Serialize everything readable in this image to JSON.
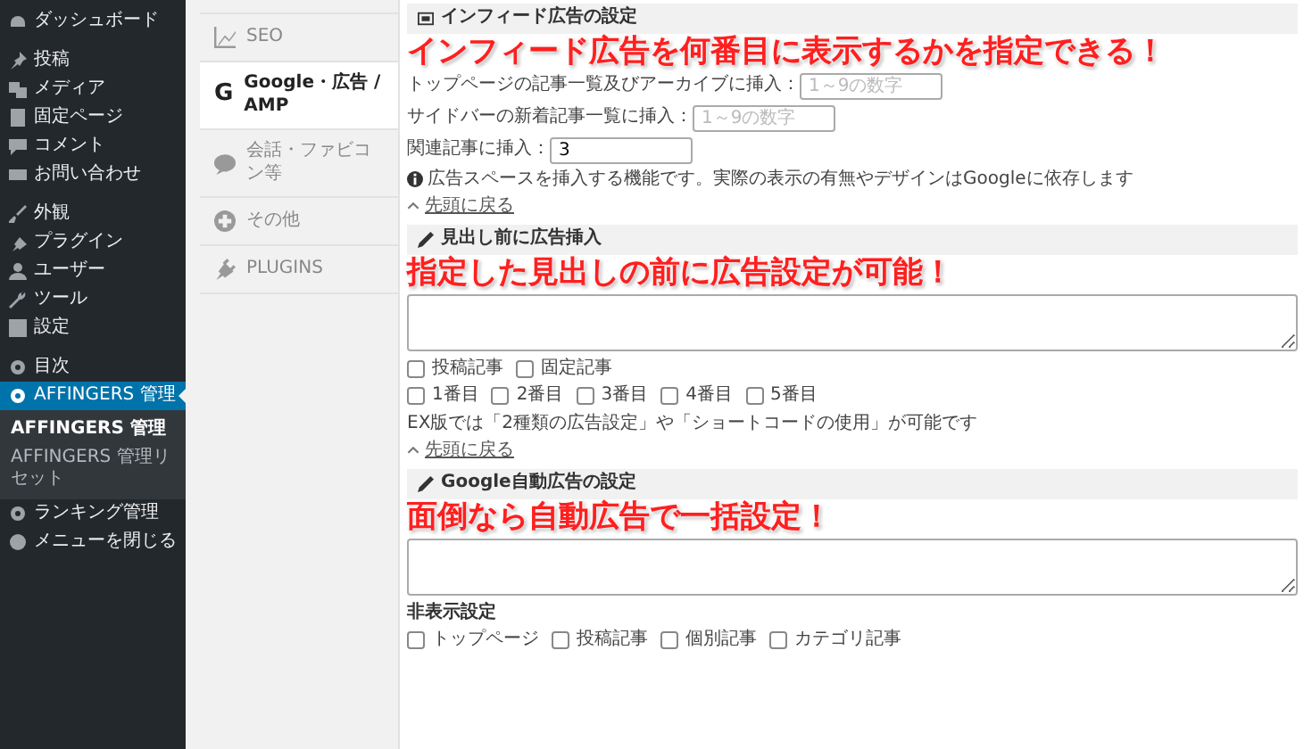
{
  "sidebar": {
    "groups": [
      {
        "items": [
          {
            "label": "ダッシュボード",
            "selected": false
          }
        ]
      },
      {
        "items": [
          {
            "label": "投稿",
            "selected": false
          },
          {
            "label": "メディア",
            "selected": false
          },
          {
            "label": "固定ページ",
            "selected": false
          },
          {
            "label": "コメント",
            "selected": false
          },
          {
            "label": "お問い合わせ",
            "selected": false
          }
        ]
      },
      {
        "items": [
          {
            "label": "外観",
            "selected": false
          },
          {
            "label": "プラグイン",
            "selected": false
          },
          {
            "label": "ユーザー",
            "selected": false
          },
          {
            "label": "ツール",
            "selected": false
          },
          {
            "label": "設定",
            "selected": false
          }
        ]
      },
      {
        "items": [
          {
            "label": "目次",
            "selected": false
          },
          {
            "label": "AFFINGERS 管理",
            "selected": true,
            "children": [
              {
                "label": "AFFINGERS 管理",
                "selected": true
              },
              {
                "label": "AFFINGERS 管理リセット",
                "selected": false
              }
            ]
          },
          {
            "label": "ランキング管理",
            "selected": false
          },
          {
            "label": "メニューを閉じる",
            "selected": false
          }
        ]
      }
    ]
  },
  "tabs": [
    {
      "label": "SEO",
      "selected": false
    },
    {
      "label": "Google・広告 / AMP",
      "glyph": "G",
      "selected": true
    },
    {
      "label": "会話・ファビコン等",
      "selected": false
    },
    {
      "label": "その他",
      "selected": false
    },
    {
      "label": "PLUGINS",
      "selected": false
    }
  ],
  "sections": [
    {
      "title": "インフィード広告の設定",
      "annotation": "インフィード広告を何番目に表示するかを指定できる！",
      "rows": [
        {
          "kind": "input",
          "label": "トップページの記事一覧及びアーカイブに挿入：",
          "placeholder": "1～9の数字"
        },
        {
          "kind": "input",
          "label": "サイドバーの新着記事一覧に挿入：",
          "placeholder": "1～9の数字"
        },
        {
          "kind": "input",
          "label": "関連記事に挿入：",
          "value": "3"
        },
        {
          "kind": "info",
          "text": "広告スペースを挿入する機能です。実際の表示の有無やデザインはGoogleに依存します"
        },
        {
          "kind": "link",
          "text": "先頭に戻る"
        }
      ]
    },
    {
      "title": "見出し前に広告挿入",
      "annotation": "指定した見出しの前に広告設定が可能！",
      "rows": [
        {
          "kind": "textarea"
        },
        {
          "kind": "checkboxes",
          "options": [
            {
              "label": "投稿記事",
              "checked": false
            },
            {
              "label": "固定記事",
              "checked": false
            }
          ]
        },
        {
          "kind": "checkboxes",
          "options": [
            {
              "label": "1番目",
              "checked": false
            },
            {
              "label": "2番目",
              "checked": false
            },
            {
              "label": "3番目",
              "checked": false
            },
            {
              "label": "4番目",
              "checked": false
            },
            {
              "label": "5番目",
              "checked": false
            }
          ]
        },
        {
          "kind": "note",
          "text": "EX版では「2種類の広告設定」や「ショートコードの使用」が可能です"
        },
        {
          "kind": "link",
          "text": "先頭に戻る"
        }
      ]
    },
    {
      "title": "Google自動広告の設定",
      "annotation": "面倒なら自動広告で一括設定！",
      "rows": [
        {
          "kind": "textarea"
        },
        {
          "kind": "subheading",
          "text": "非表示設定"
        },
        {
          "kind": "checkboxes",
          "options": [
            {
              "label": "トップページ",
              "checked": false
            },
            {
              "label": "投稿記事",
              "checked": false
            },
            {
              "label": "個別記事",
              "checked": false
            },
            {
              "label": "カテゴリ記事",
              "checked": false
            }
          ]
        }
      ]
    }
  ]
}
